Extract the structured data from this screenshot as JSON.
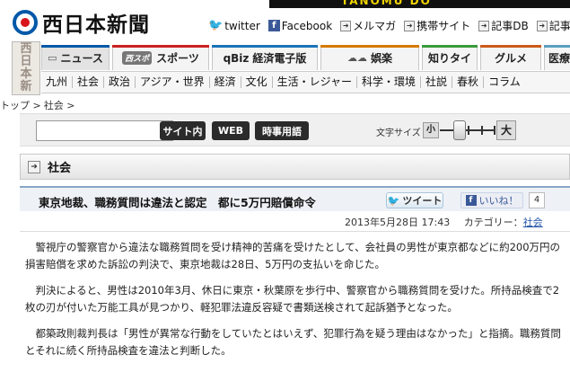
{
  "header": {
    "site_name": "西日本新聞",
    "ad_text": "TANOMU DO",
    "links": [
      {
        "label": "twitter",
        "icon": "twitter-icon"
      },
      {
        "label": "Facebook",
        "icon": "facebook-icon"
      },
      {
        "label": "メルマガ",
        "icon": "arrow-icon"
      },
      {
        "label": "携帯サイト",
        "icon": "arrow-icon"
      },
      {
        "label": "記事DB",
        "icon": "arrow-icon"
      },
      {
        "label": "記事",
        "icon": "arrow-icon"
      }
    ]
  },
  "side_logo": "西日本新聞",
  "categories": [
    {
      "label": "ニュース"
    },
    {
      "label": "スポーツ",
      "logo": "西スポ"
    },
    {
      "label": "経済電子版",
      "prefix": "qBiz"
    },
    {
      "label": "娯楽"
    },
    {
      "label": "知りタイ"
    },
    {
      "label": "グルメ"
    },
    {
      "label": "医療"
    }
  ],
  "subnav": [
    "九州",
    "社会",
    "政治",
    "アジア・世界",
    "経済",
    "文化",
    "生活・レジャー",
    "科学・環境",
    "社説",
    "春秋",
    "コラム"
  ],
  "breadcrumb": [
    "トップ >",
    "社会 >"
  ],
  "search": {
    "placeholder": "",
    "buttons": [
      "サイト内",
      "WEB",
      "時事用語"
    ],
    "font_size_label": "文字サイズ",
    "font_small": "小",
    "font_large": "大"
  },
  "section": {
    "label": "社会"
  },
  "article": {
    "title": "東京地裁、職務質問は違法と認定　都に5万円賠償命令",
    "tweet_label": "ツイート",
    "like_label": "いいね！",
    "like_count": "4",
    "date": "2013年5月28日 17:43",
    "category_label": "カテゴリー：",
    "category": "社会",
    "paragraphs": [
      "警視庁の警察官から違法な職務質問を受け精神的苦痛を受けたとして、会社員の男性が東京都などに約200万円の損害賠償を求めた訴訟の判決で、東京地裁は28日、5万円の支払いを命じた。",
      "判決によると、男性は2010年3月、休日に東京・秋葉原を歩行中、警察官から職務質問を受けた。所持品検査で2枚の刃が付いた万能工具が見つかり、軽犯罪法違反容疑で書類送検されて起訴猶予となった。",
      "都築政則裁判長は「男性が異常な行動をしていたとはいえず、犯罪行為を疑う理由はなかった」と指摘。職務質問とそれに続く所持品検査を違法と判断した。"
    ]
  },
  "colors": {
    "brand_blue": "#0058a8",
    "brand_red": "#d8151b",
    "link": "#2255aa"
  }
}
